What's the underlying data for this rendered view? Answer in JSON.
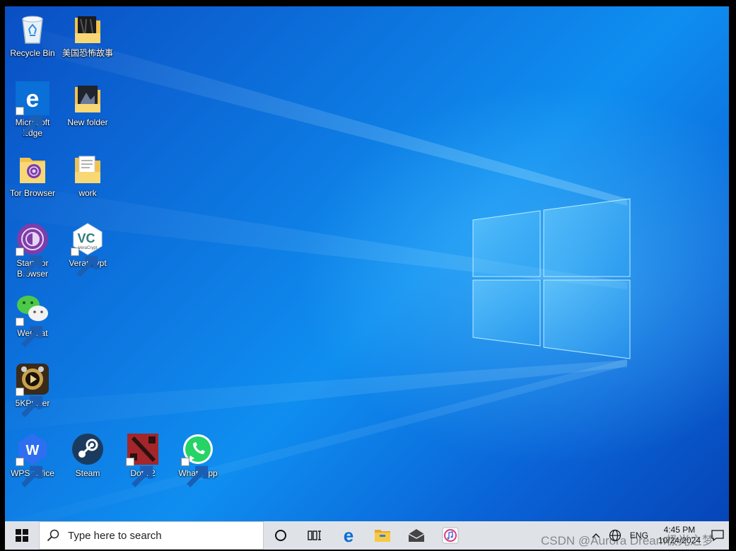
{
  "desktop": {
    "icons": [
      {
        "label": "Recycle Bin"
      },
      {
        "label": "美国恐怖故事"
      },
      {
        "label": "Microsoft Edge"
      },
      {
        "label": "New folder"
      },
      {
        "label": "Tor Browser"
      },
      {
        "label": "work"
      },
      {
        "label": "Start Tor Browser"
      },
      {
        "label": "VeraCrypt"
      },
      {
        "label": "WeChat"
      },
      {
        "label": "5KPlayer"
      },
      {
        "label": "WPS Office"
      },
      {
        "label": "Steam"
      },
      {
        "label": "Dota 2"
      },
      {
        "label": "WhatsApp"
      }
    ]
  },
  "taskbar": {
    "search_placeholder": "Type here to search",
    "tray": {
      "language": "ENG",
      "time": "4:45 PM",
      "date": "10/24/2024"
    }
  },
  "watermark": "CSDN @Aurora Dream极光之梦",
  "colors": {
    "taskbar": "#dfe3e8",
    "desktop_blue": "#0d77e0",
    "accent": "#0078d7"
  }
}
